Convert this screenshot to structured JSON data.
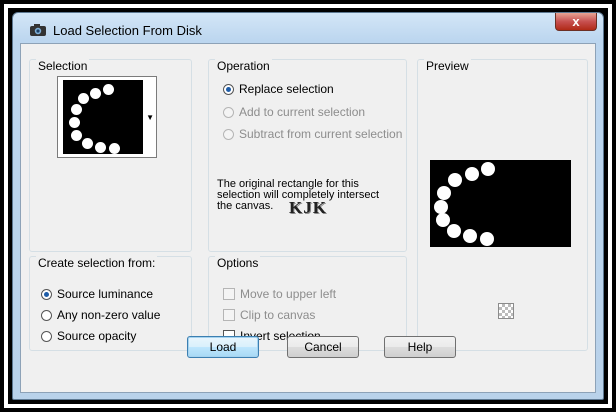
{
  "window": {
    "title": "Load Selection From Disk",
    "close_glyph": "x"
  },
  "selection": {
    "label": "Selection",
    "dropdown_glyph": "▼"
  },
  "operation": {
    "label": "Operation",
    "options": [
      {
        "label": "Replace selection",
        "selected": true,
        "enabled": true
      },
      {
        "label": "Add to current selection",
        "selected": false,
        "enabled": false
      },
      {
        "label": "Subtract from current selection",
        "selected": false,
        "enabled": false
      }
    ],
    "note": "The original rectangle for this selection will completely intersect the canvas.",
    "watermark": "KJK"
  },
  "preview": {
    "label": "Preview",
    "icon": "checkerboard-icon"
  },
  "create_from": {
    "label": "Create selection from:",
    "options": [
      {
        "label": "Source luminance",
        "selected": true
      },
      {
        "label": "Any non-zero value",
        "selected": false
      },
      {
        "label": "Source opacity",
        "selected": false
      }
    ]
  },
  "options": {
    "label": "Options",
    "items": [
      {
        "label": "Move to upper left",
        "checked": false,
        "enabled": false
      },
      {
        "label": "Clip to canvas",
        "checked": false,
        "enabled": false
      },
      {
        "label": "Invert selection",
        "checked": false,
        "enabled": true
      }
    ]
  },
  "buttons": {
    "load": "Load",
    "cancel": "Cancel",
    "help": "Help"
  }
}
